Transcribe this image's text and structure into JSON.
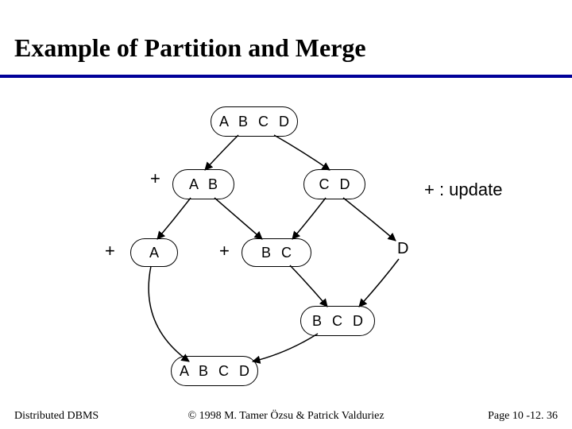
{
  "title": "Example of Partition and Merge",
  "nodes": {
    "root": "A B C D",
    "ab": "A B",
    "cd": "C D",
    "a": "A",
    "bc": "B C",
    "bcd": "B C D",
    "abcd2": "A B C D"
  },
  "labels": {
    "plus": "+",
    "d": "D",
    "legend": "+ : update"
  },
  "footer": {
    "left": "Distributed DBMS",
    "center": "© 1998 M. Tamer Özsu & Patrick Valduriez",
    "right": "Page 10 -12. 36"
  }
}
